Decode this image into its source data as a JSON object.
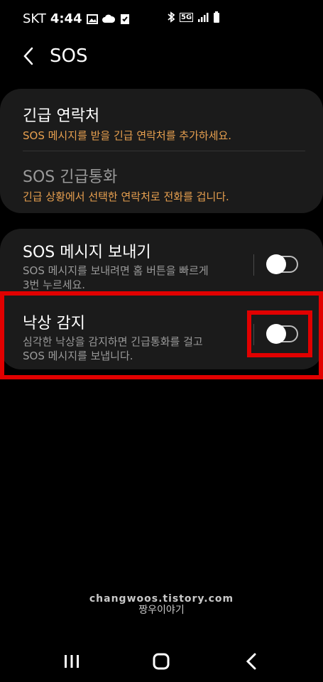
{
  "status_bar": {
    "carrier": "SKT",
    "time": "4:44",
    "network": "5G",
    "icons": [
      "image-icon",
      "cloud-icon",
      "check-icon",
      "bluetooth-icon",
      "signal-icon",
      "battery-icon"
    ]
  },
  "header": {
    "back_icon": "back-arrow-icon",
    "title": "SOS"
  },
  "emergency_group": {
    "contacts": {
      "title": "긴급 연락처",
      "subtitle": "SOS 메시지를 받을 긴급 연락처를 추가하세요."
    },
    "sos_call": {
      "title": "SOS 긴급통화",
      "subtitle": "긴급 상황에서 선택한 연락처로 전화를 겁니다."
    }
  },
  "sos_group": {
    "send_sos": {
      "title": "SOS 메시지 보내기",
      "subtitle_line1": "SOS 메시지를 보내려면 홈 버튼을 빠르게",
      "subtitle_line2": "3번 누르세요.",
      "toggle_on": false
    },
    "fall_detection": {
      "title": "낙상 감지",
      "subtitle_line1": "심각한 낙상을 감지하면 긴급통화를 걸고",
      "subtitle_line2": "SOS 메시지를 보냅니다.",
      "toggle_on": false
    }
  },
  "watermark": {
    "line1": "changwoos.tistory.com",
    "line2": "짱우이야기"
  },
  "navbar": {
    "recent_icon": "recent-apps-icon",
    "home_icon": "home-icon",
    "back_icon": "back-icon"
  },
  "colors": {
    "background": "#000000",
    "card": "#1b1b1b",
    "accent_orange": "#e8a04f",
    "highlight_red": "#e10000"
  }
}
